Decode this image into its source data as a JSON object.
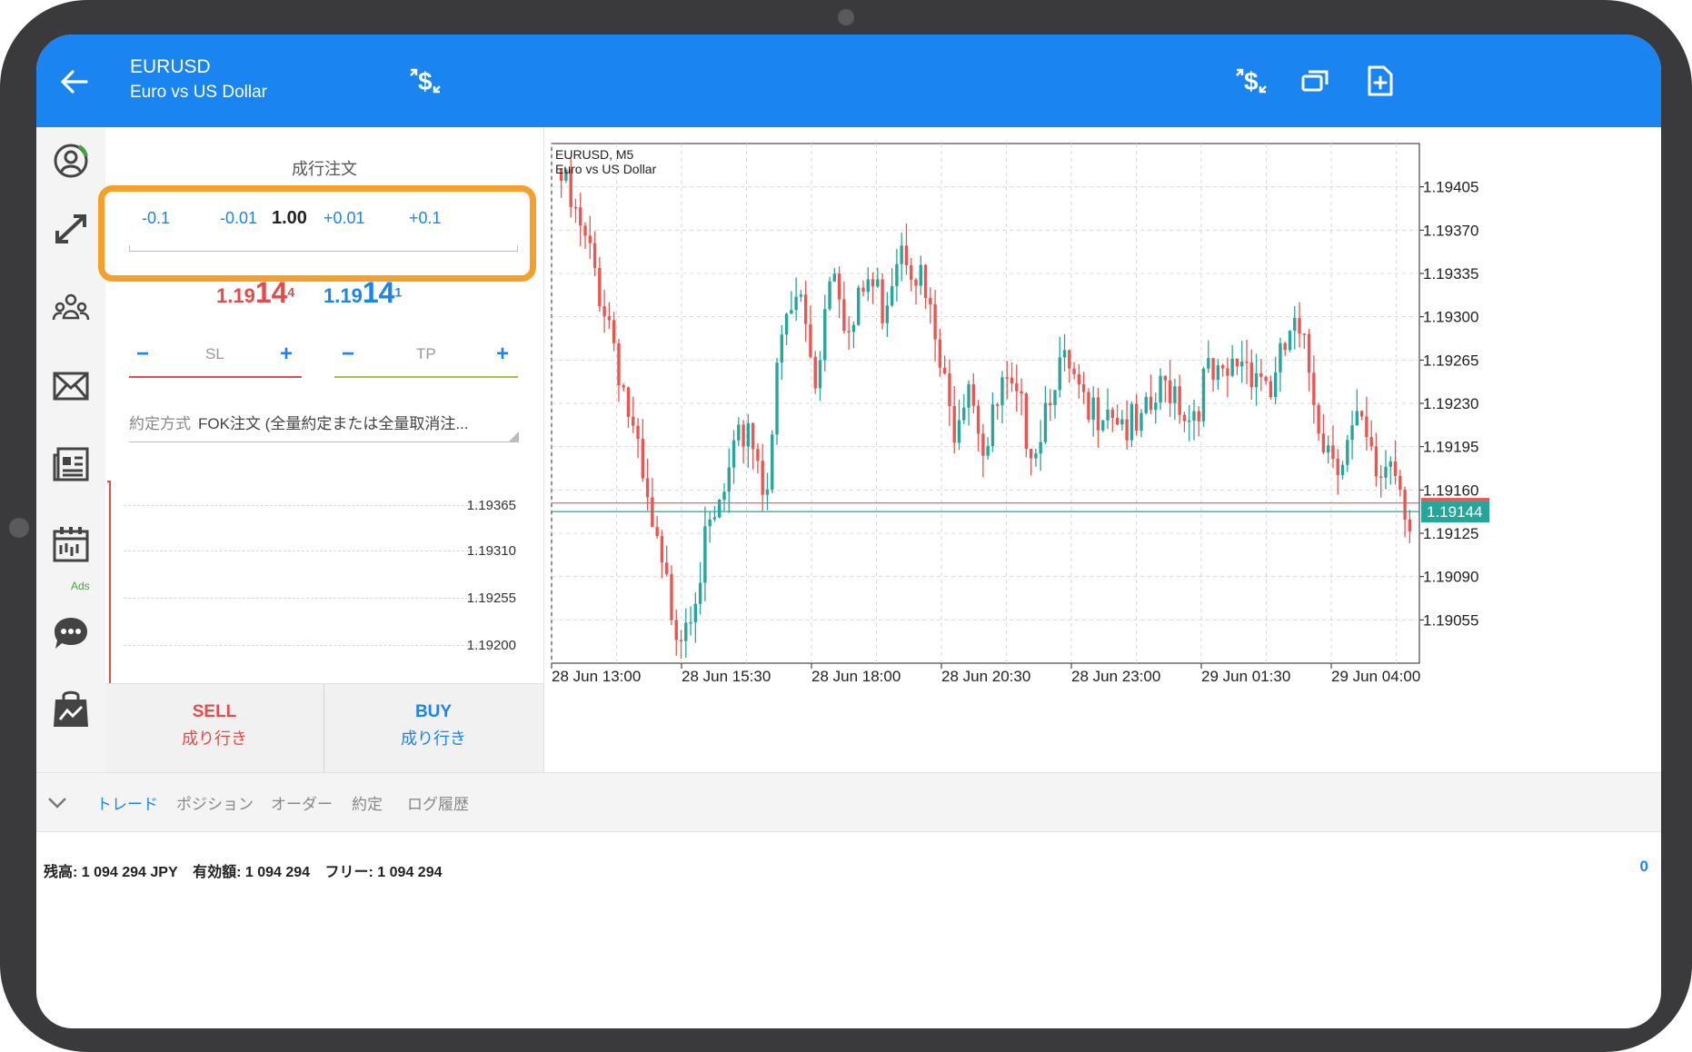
{
  "header": {
    "symbol": "EURUSD",
    "description": "Euro vs US Dollar",
    "accent": "#1a85f1"
  },
  "sidebar": {
    "icons": [
      "account-icon",
      "trade-icon",
      "community-icon",
      "mail-icon",
      "news-icon",
      "calendar-icon",
      "chat-icon",
      "market-icon"
    ],
    "ads_label": "Ads"
  },
  "order": {
    "title": "成行注文",
    "volume": {
      "minus_01": "-0.1",
      "minus_001": "-0.01",
      "value": "1.00",
      "plus_001": "+0.01",
      "plus_01": "+0.1"
    },
    "bid": {
      "small": "1.19",
      "big": "14",
      "sup": "4"
    },
    "ask": {
      "small": "1.19",
      "big": "14",
      "sup": "1"
    },
    "sl": {
      "label": "SL",
      "minus": "−",
      "plus": "+"
    },
    "tp": {
      "label": "TP",
      "minus": "−",
      "plus": "+"
    },
    "fill_label": "約定方式",
    "fill_value": "FOK注文 (全量約定または全量取消注...",
    "mini_levels": [
      "1.19365",
      "1.19310",
      "1.19255",
      "1.19200"
    ],
    "sell": {
      "label": "SELL",
      "sub": "成り行き"
    },
    "buy": {
      "label": "BUY",
      "sub": "成り行き"
    },
    "colors": {
      "sell": "#e64a4a",
      "buy": "#1a85f1",
      "tp_line": "#a6c43a"
    }
  },
  "chart_data": {
    "type": "candlestick",
    "title": "EURUSD, M5",
    "subtitle": "Euro vs US Dollar",
    "ylim": [
      1.1902,
      1.1944
    ],
    "y_ticks": [
      1.19405,
      1.1937,
      1.19335,
      1.193,
      1.19265,
      1.1923,
      1.19195,
      1.1916,
      1.19125,
      1.1909,
      1.19055
    ],
    "x_labels": [
      "28 Jun 13:00",
      "28 Jun 15:30",
      "28 Jun 18:00",
      "28 Jun 20:30",
      "28 Jun 23:00",
      "29 Jun 01:30",
      "29 Jun 04:00"
    ],
    "current_price": "1.19144",
    "bid_line": 1.19144,
    "ask_line": 1.19148,
    "grid": true,
    "up_color": "#26a69a",
    "down_color": "#ef5350",
    "keypoints": [
      1.1941,
      1.1937,
      1.19335,
      1.1929,
      1.1922,
      1.19145,
      1.19085,
      1.1905,
      1.1909,
      1.1913,
      1.1917,
      1.1922,
      1.1916,
      1.1928,
      1.1932,
      1.1925,
      1.1936,
      1.1928,
      1.1933,
      1.1931,
      1.1937,
      1.1934,
      1.1928,
      1.1921,
      1.1926,
      1.1919,
      1.1924,
      1.1922,
      1.192,
      1.1926,
      1.1925,
      1.1921,
      1.1924,
      1.1922,
      1.192,
      1.1923,
      1.1925,
      1.1922,
      1.1925,
      1.1924,
      1.1927,
      1.1926,
      1.1924,
      1.1929,
      1.1926,
      1.192,
      1.1919,
      1.1921,
      1.1917,
      1.1919,
      1.1914
    ]
  },
  "bottom": {
    "tabs": [
      "トレード",
      "ポジション",
      "オーダー",
      "約定",
      "ログ履歴"
    ],
    "active_tab": 0,
    "balance": "残高:  1 094 294 JPY",
    "equity": "有効額:  1 094 294",
    "free": "フリー:  1 094 294",
    "right_value": "0"
  }
}
